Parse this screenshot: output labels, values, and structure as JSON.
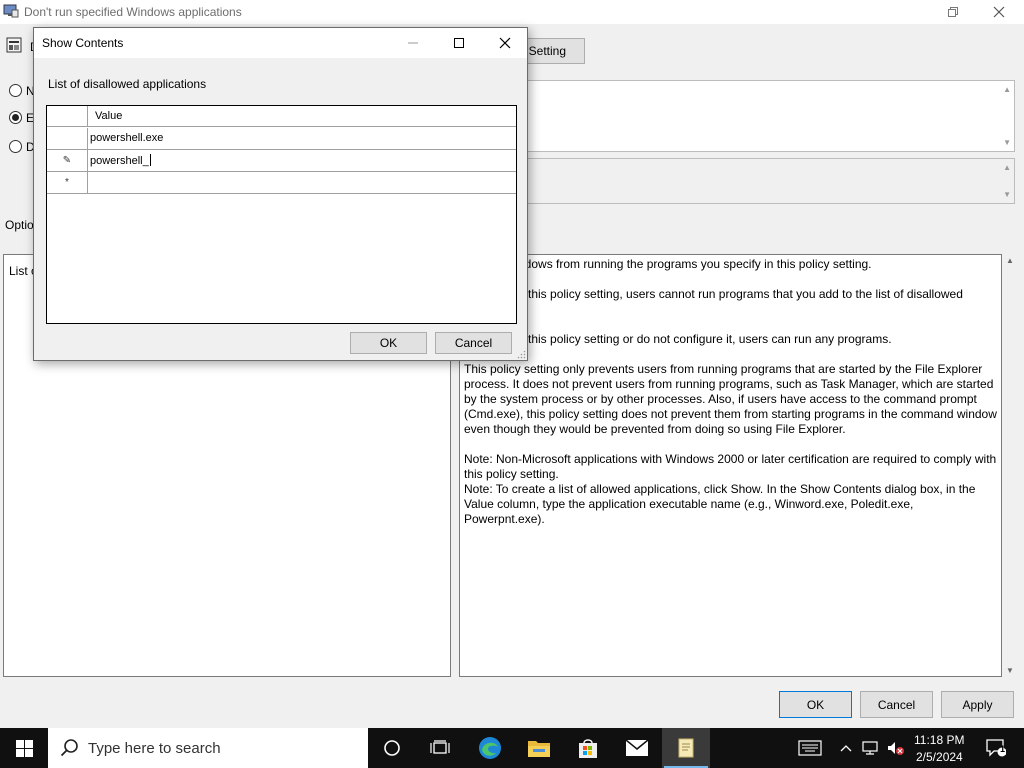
{
  "main_window": {
    "title": "Don't run specified Windows applications",
    "setting_button_partial": "Setting",
    "radio_not_configured_partial": "N",
    "radio_enabled_partial": "E",
    "radio_disabled_partial": "D",
    "options_label_partial": "Optio",
    "options_list_label_partial": "List o",
    "help_paragraphs": [
      "ndows from running the programs you specify in this policy setting.",
      "e this policy setting, users cannot run programs that you add to the list of disallowed",
      "e this policy setting or do not configure it, users can run any programs.",
      "This policy setting only prevents users from running programs that are started by the File Explorer process. It does not prevent users from running programs, such as Task Manager, which are started by the system process or by other processes.  Also, if users have access to the command prompt (Cmd.exe), this policy setting does not prevent them from starting programs in the command window even though they would be prevented from doing so using File Explorer.",
      "Note: Non-Microsoft applications with Windows 2000 or later certification are required to comply with this policy setting.",
      "Note: To create a list of allowed applications, click Show.  In the Show Contents dialog box, in the Value column, type the application executable name (e.g., Winword.exe, Poledit.exe, Powerpnt.exe)."
    ],
    "help_line2_tail": ".",
    "buttons": {
      "ok": "OK",
      "cancel": "Cancel",
      "apply": "Apply"
    }
  },
  "dialog": {
    "title": "Show Contents",
    "list_label": "List of disallowed applications",
    "column_header": "Value",
    "rows": [
      {
        "selector": "",
        "value": "powershell.exe"
      },
      {
        "selector": "✎",
        "value": "powershell_"
      },
      {
        "selector": "*",
        "value": ""
      }
    ],
    "buttons": {
      "ok": "OK",
      "cancel": "Cancel"
    }
  },
  "taskbar": {
    "search_placeholder": "Type here to search",
    "clock_time": "11:18 PM",
    "clock_date": "2/5/2024",
    "notification_count": "1"
  },
  "colors": {
    "accent": "#0078d7",
    "taskbar": "#101010",
    "active_indicator": "#76b9ed"
  }
}
